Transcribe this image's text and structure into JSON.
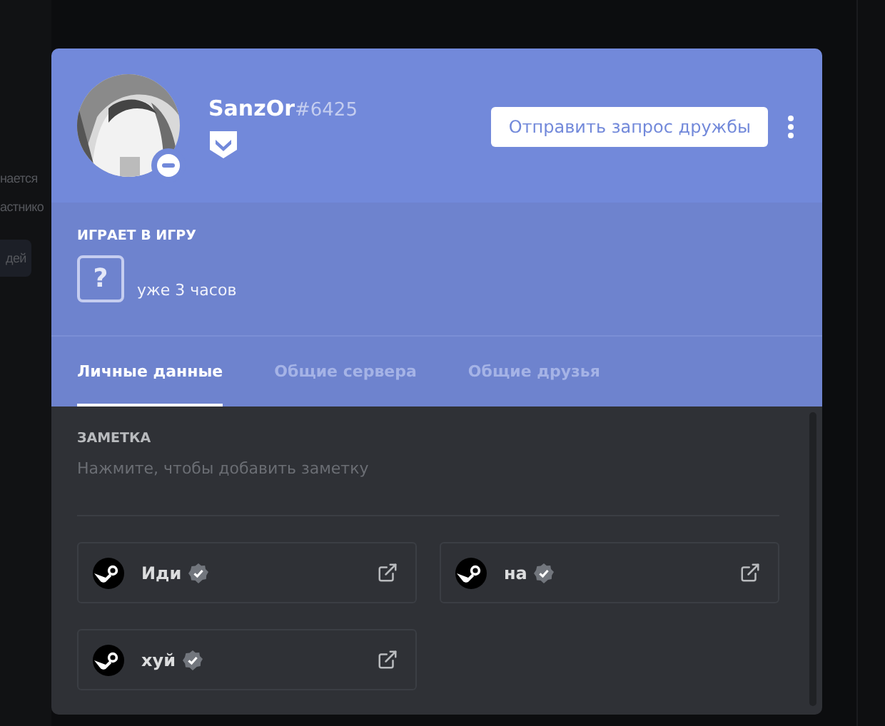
{
  "background": {
    "fragments": [
      "нается",
      "астнико",
      "дей"
    ]
  },
  "profile": {
    "username": "SanzOr",
    "discriminator": "#6425"
  },
  "actions": {
    "primary": "Отправить запрос дружбы"
  },
  "activity": {
    "header": "ИГРАЕТ В ИГРУ",
    "icon": "?",
    "elapsed": "уже 3 часов"
  },
  "tabs": [
    {
      "label": "Личные данные",
      "selected": true
    },
    {
      "label": "Общие сервера",
      "selected": false
    },
    {
      "label": "Общие друзья",
      "selected": false
    }
  ],
  "note": {
    "label": "ЗАМЕТКА",
    "placeholder": "Нажмите, чтобы добавить заметку"
  },
  "connections": [
    {
      "name": "Иди",
      "verified": true
    },
    {
      "name": "на",
      "verified": true
    },
    {
      "name": "хуй",
      "verified": true
    }
  ]
}
